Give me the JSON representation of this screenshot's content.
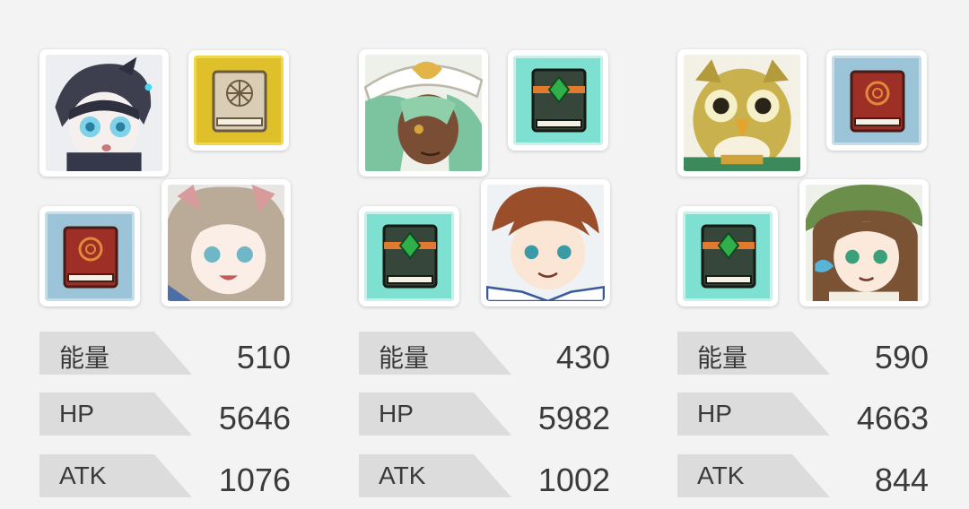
{
  "colors": {
    "background": "#f3f3f3",
    "label_band": "#dcdcdc",
    "text": "#3a3a3a"
  },
  "teams": [
    {
      "characters": [
        {
          "portrait": "dark-armored-girl-portrait"
        },
        {
          "portrait": "cat-eared-girl-portrait"
        }
      ],
      "items": [
        {
          "icon": "gold-rune-book-icon"
        },
        {
          "icon": "red-spellbook-icon"
        }
      ],
      "stats": [
        {
          "label": "能量",
          "value": "510"
        },
        {
          "label": "HP",
          "value": "5646"
        },
        {
          "label": "ATK",
          "value": "1076"
        }
      ]
    },
    {
      "characters": [
        {
          "portrait": "green-haired-hat-man-portrait"
        },
        {
          "portrait": "brown-haired-boy-portrait"
        }
      ],
      "items": [
        {
          "icon": "green-gem-book-icon"
        },
        {
          "icon": "green-gem-book-icon"
        }
      ],
      "stats": [
        {
          "label": "能量",
          "value": "430"
        },
        {
          "label": "HP",
          "value": "5982"
        },
        {
          "label": "ATK",
          "value": "1002"
        }
      ]
    },
    {
      "characters": [
        {
          "portrait": "owl-portrait"
        },
        {
          "portrait": "green-hat-girl-portrait"
        }
      ],
      "items": [
        {
          "icon": "red-spellbook-icon"
        },
        {
          "icon": "green-gem-book-icon"
        }
      ],
      "stats": [
        {
          "label": "能量",
          "value": "590"
        },
        {
          "label": "HP",
          "value": "4663"
        },
        {
          "label": "ATK",
          "value": "844"
        }
      ]
    }
  ]
}
